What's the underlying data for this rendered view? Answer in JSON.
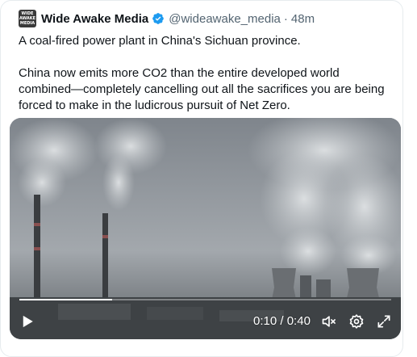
{
  "tweet": {
    "author_name": "Wide Awake Media",
    "avatar_text": [
      "WIDE",
      "AWAKE",
      "MEDIA"
    ],
    "handle": "@wideawake_media",
    "separator": "·",
    "time": "48m",
    "verified_color": "#1d9bf0",
    "paragraphs": [
      "A coal-fired power plant in China's Sichuan province.",
      "China now emits more CO2 than the entire developed world combined—completely cancelling out all the sacrifices you are being forced to make in the ludicrous pursuit of Net Zero."
    ]
  },
  "video": {
    "current_time": "0:10",
    "separator": " / ",
    "duration": "0:40",
    "progress_fraction": 0.25,
    "icons": [
      "play-icon",
      "mute-icon",
      "settings-gear-icon",
      "fullscreen-icon"
    ]
  }
}
